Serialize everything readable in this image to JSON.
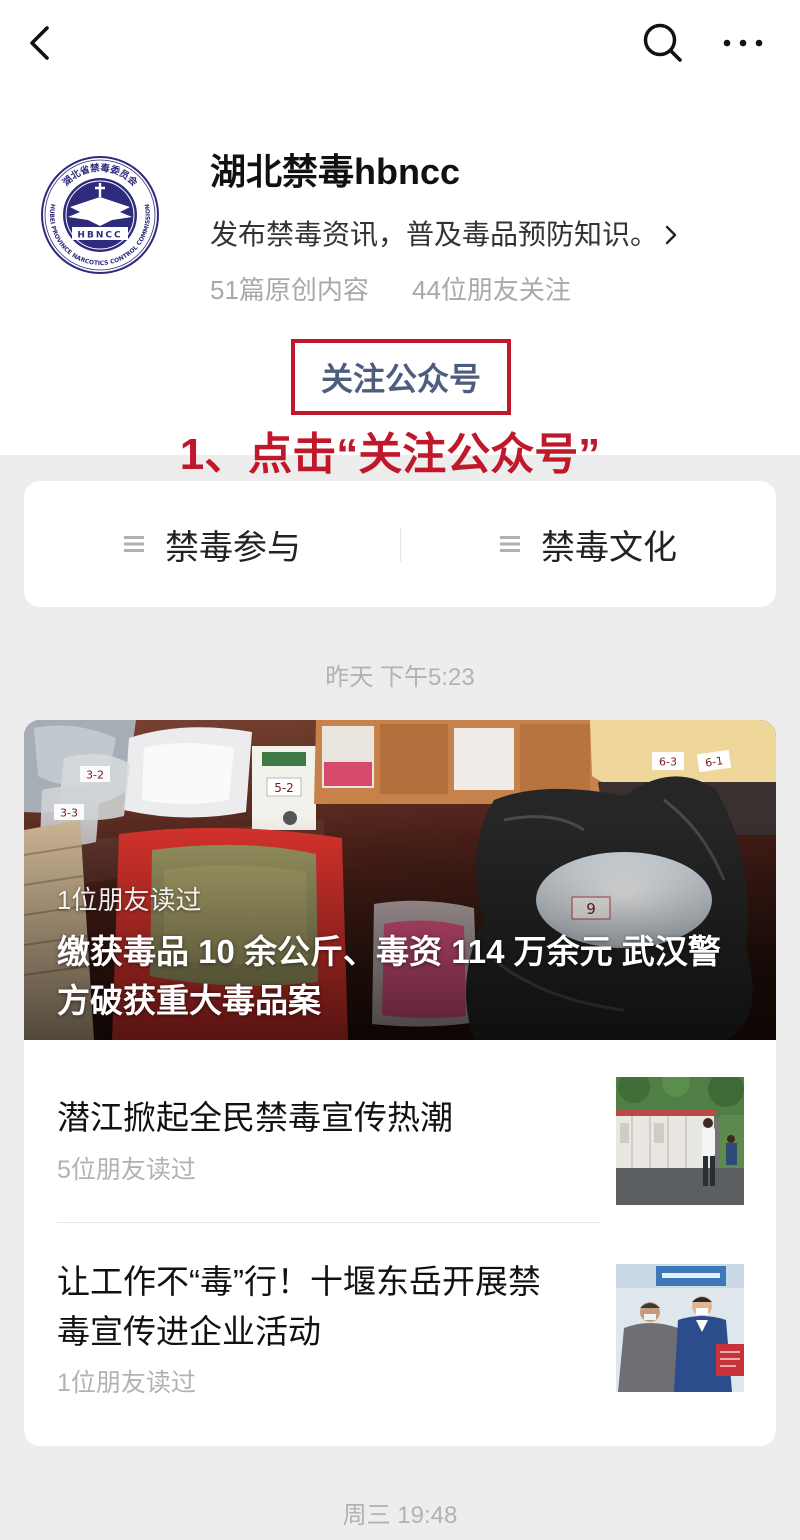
{
  "nav": {
    "back_icon": "chevron-left-icon",
    "search_icon": "search-icon",
    "more_icon": "more-dots-icon"
  },
  "profile": {
    "logo": {
      "ring_text_cn": "湖北省禁毒委员会",
      "ring_text_en": "HUBEI PROVINCE NARCOTICS CONTROL COMMISSION",
      "center_text": "HBNCC"
    },
    "name": "湖北禁毒hbncc",
    "description": "发布禁毒资讯，普及毒品预防知识。",
    "description_icon": "chevron-right-icon",
    "original_count": "51篇原创内容",
    "friends_following": "44位朋友关注",
    "follow_button": "关注公众号"
  },
  "annotation": {
    "text": "1、点击“关注公众号”"
  },
  "menu": [
    {
      "icon": "menu-lines-icon",
      "label": "禁毒参与"
    },
    {
      "icon": "menu-lines-icon",
      "label": "禁毒文化"
    }
  ],
  "feed": [
    {
      "timestamp": "昨天 下午5:23",
      "hero": {
        "read_by": "1位朋友读过",
        "title": "缴获毒品 10 余公斤、毒资 114 万余元 武汉警方破获重大毒品案",
        "photo_labels": [
          "3-2",
          "3-3",
          "5-2",
          "9",
          "6-3",
          "6-1"
        ]
      },
      "items": [
        {
          "title": "潜江掀起全民禁毒宣传热潮",
          "read_by": "5位朋友读过"
        },
        {
          "title": "让工作不“毒”行！十堰东岳开展禁毒宣传进企业活动",
          "read_by": "1位朋友读过"
        }
      ]
    },
    {
      "timestamp": "周三 19:48"
    }
  ],
  "colors": {
    "page_bg": "#ededed",
    "card_bg": "#ffffff",
    "text_primary": "#111111",
    "meta_gray": "#b2b2b2",
    "follow_text": "#4d5d7e",
    "annotation_red": "#c0182b"
  }
}
